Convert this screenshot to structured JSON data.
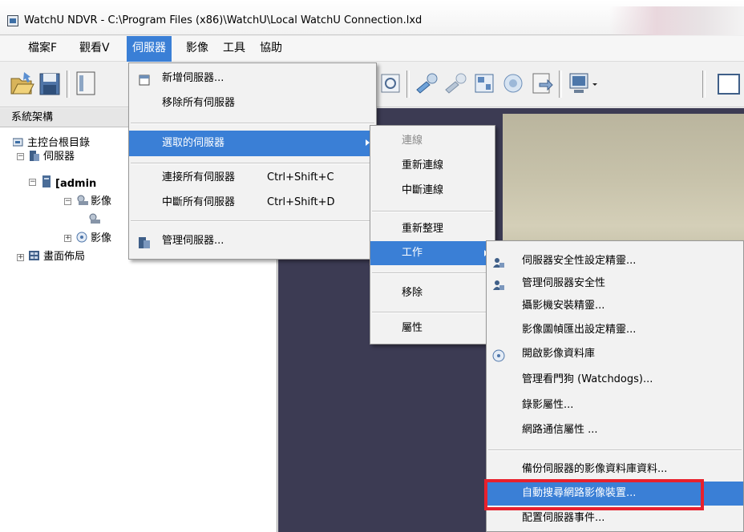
{
  "window": {
    "title": "WatchU NDVR - C:\\Program Files (x86)\\WatchU\\Local WatchU Connection.lxd"
  },
  "menubar": [
    {
      "label": "檔案F"
    },
    {
      "label": "觀看V"
    },
    {
      "label": "伺服器",
      "active": true
    },
    {
      "label": "影像"
    },
    {
      "label": "工具"
    },
    {
      "label": "協助"
    }
  ],
  "tree": {
    "header": "系統架構",
    "root": "主控台根目錄",
    "servers": "伺服器",
    "admin": "[admin",
    "video1": "影像",
    "video2": "影像",
    "layout": "畫面佈局"
  },
  "server_menu": {
    "add": "新增伺服器...",
    "remove_all": "移除所有伺服器",
    "selected": "選取的伺服器",
    "connect_all": "連接所有伺服器",
    "connect_all_shortcut": "Ctrl+Shift+C",
    "disconnect_all": "中斷所有伺服器",
    "disconnect_all_shortcut": "Ctrl+Shift+D",
    "manage": "管理伺服器..."
  },
  "selected_menu": {
    "connect": "連線",
    "reconnect": "重新連線",
    "disconnect": "中斷連線",
    "refresh": "重新整理",
    "work": "工作",
    "remove": "移除",
    "properties": "屬性"
  },
  "work_menu": {
    "security_wizard": "伺服器安全性設定精靈...",
    "manage_security": "管理伺服器安全性",
    "camera_wizard": "攝影機安裝精靈...",
    "frame_export_wizard": "影像圖幀匯出設定精靈...",
    "open_database": "開啟影像資料庫",
    "watchdogs": "管理看門狗 (Watchdogs)...",
    "recording_props": "錄影屬性...",
    "network_props": "網路通信屬性 ...",
    "backup": "備份伺服器的影像資料庫資料...",
    "auto_search": "自動搜尋網路影像裝置...",
    "config_events": "配置伺服器事件..."
  },
  "colors": {
    "highlight": "#3a7fd6",
    "annotation": "#e8212d",
    "video_bg": "#3c3b53"
  }
}
